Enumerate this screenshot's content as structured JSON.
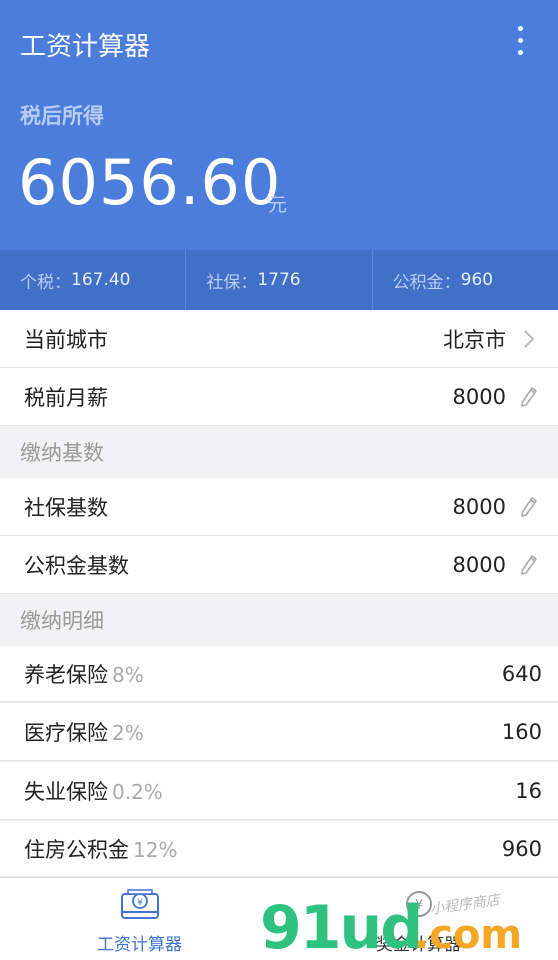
{
  "header": {
    "title": "工资计算器",
    "after_tax_label": "税后所得",
    "after_tax_value": "6056.60",
    "after_tax_unit": "元"
  },
  "stats": [
    {
      "label": "个税：",
      "value": "167.40"
    },
    {
      "label": "社保：",
      "value": "1776"
    },
    {
      "label": "公积金：",
      "value": "960"
    }
  ],
  "basic": {
    "city_label": "当前城市",
    "city_value": "北京市",
    "salary_label": "税前月薪",
    "salary_value": "8000"
  },
  "base_section": {
    "title": "缴纳基数",
    "social_label": "社保基数",
    "social_value": "8000",
    "fund_label": "公积金基数",
    "fund_value": "8000"
  },
  "detail_section": {
    "title": "缴纳明细",
    "items": [
      {
        "name": "养老保险",
        "rate": "8%",
        "value": "640"
      },
      {
        "name": "医疗保险",
        "rate": "2%",
        "value": "160"
      },
      {
        "name": "失业保险",
        "rate": "0.2%",
        "value": "16"
      },
      {
        "name": "住房公积金",
        "rate": "12%",
        "value": "960"
      }
    ]
  },
  "tabs": [
    {
      "label": "工资计算器",
      "icon": "salary-card-icon",
      "active": true
    },
    {
      "label": "奖金计算器",
      "icon": "bonus-icon",
      "active": false
    }
  ],
  "watermark": {
    "text": "91ud.com",
    "sub": "小程序商店"
  },
  "colors": {
    "primary": "#4a7ddc",
    "stats_bg": "#4170c9",
    "active_tab": "#3e74d6",
    "watermark_green": "#2ec27e",
    "watermark_orange": "#f5a623"
  }
}
